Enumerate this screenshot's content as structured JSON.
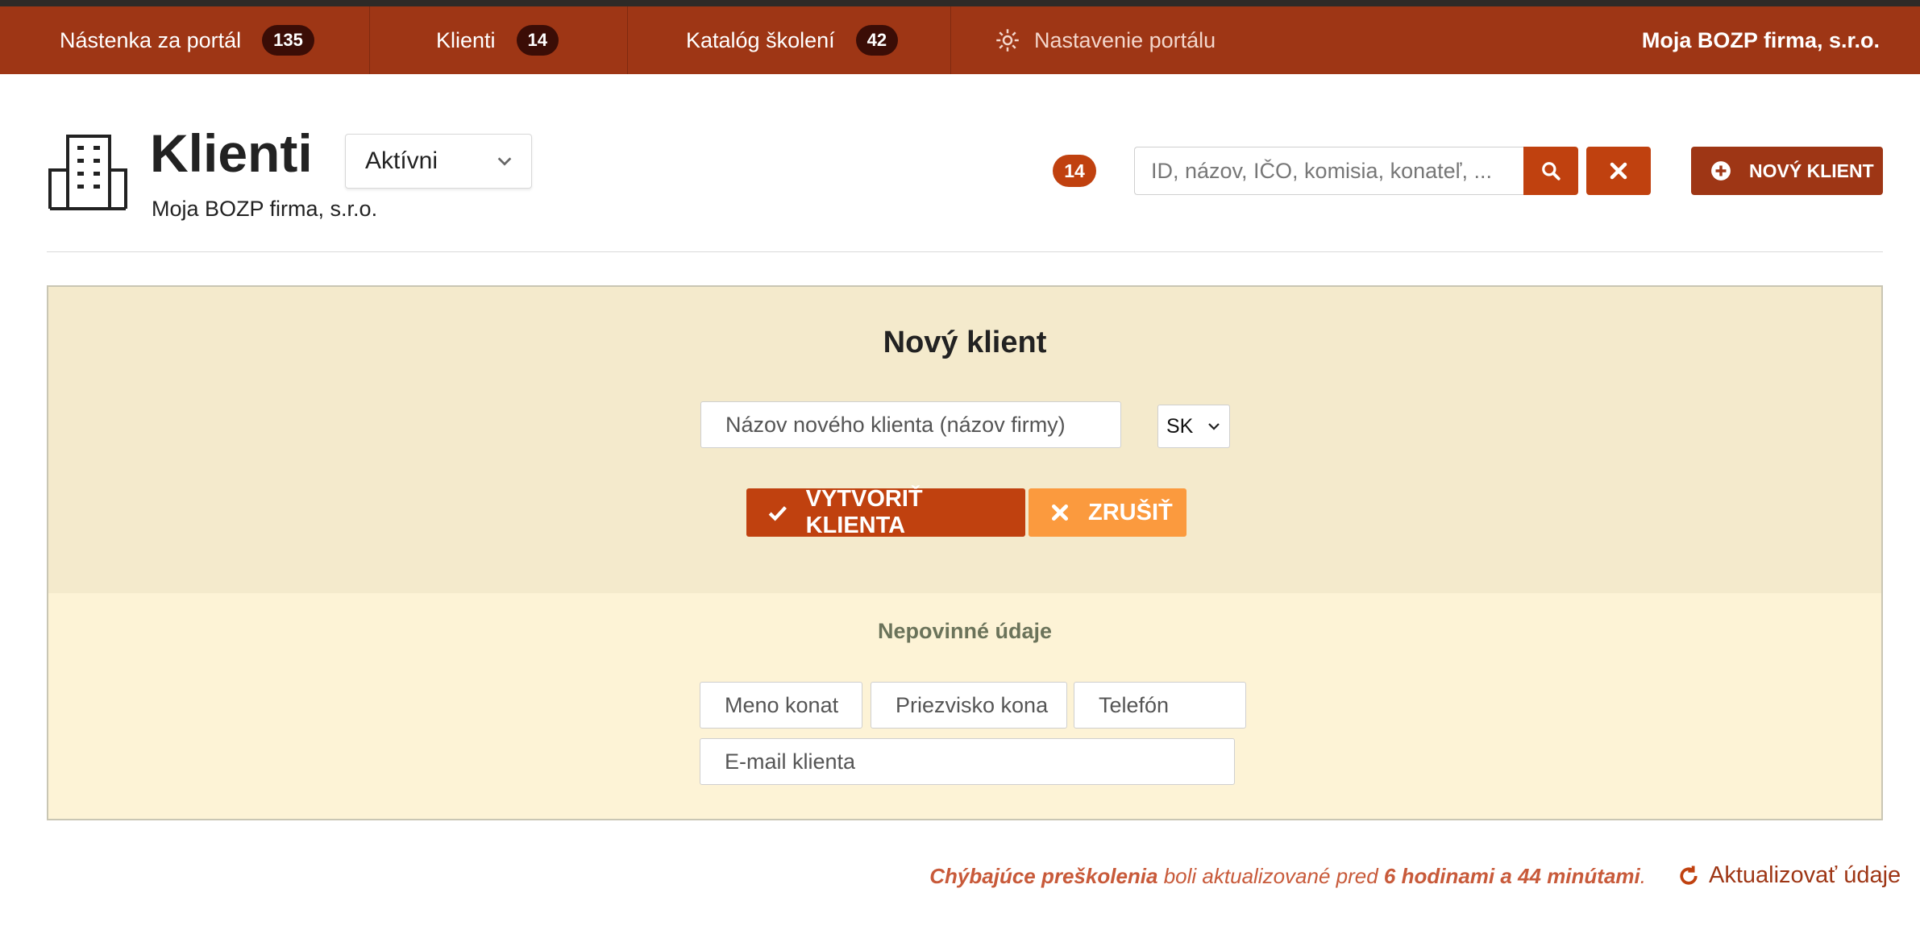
{
  "nav": {
    "items": [
      {
        "label": "Nástenka za portál",
        "count": "135"
      },
      {
        "label": "Klienti",
        "count": "14"
      },
      {
        "label": "Katalóg školení",
        "count": "42"
      }
    ],
    "settings_label": "Nastavenie portálu",
    "brand": "Moja BOZP firma, s.r.o."
  },
  "header": {
    "title": "Klienti",
    "subtitle": "Moja BOZP firma, s.r.o.",
    "status_filter": "Aktívni",
    "count": "14",
    "search_placeholder": "ID, názov, IČO, komisia, konateľ, ...",
    "new_client_label": "NOVÝ KLIENT"
  },
  "form": {
    "title": "Nový klient",
    "name_placeholder": "Názov nového klienta (názov firmy)",
    "country": "SK",
    "create_label": "VYTVORIŤ KLIENTA",
    "cancel_label": "ZRUŠIŤ",
    "optional_title": "Nepovinné údaje",
    "first_name_placeholder": "Meno konat",
    "last_name_placeholder": "Priezvisko kona",
    "phone_placeholder": "Telefón",
    "email_placeholder": "E-mail klienta"
  },
  "footer": {
    "missing_label": "Chýbajúce preškolenia",
    "updated_text": " boli aktualizované pred ",
    "time_ago": "6 hodinami a 44 minútami",
    "period": ".",
    "refresh_label": "Aktualizovať údaje"
  },
  "colors": {
    "nav_bg": "#9e3615",
    "accent": "#c0410f",
    "cancel": "#fb9a3e",
    "panel_top": "#f4eacc",
    "panel_bottom": "#fdf3d6"
  }
}
